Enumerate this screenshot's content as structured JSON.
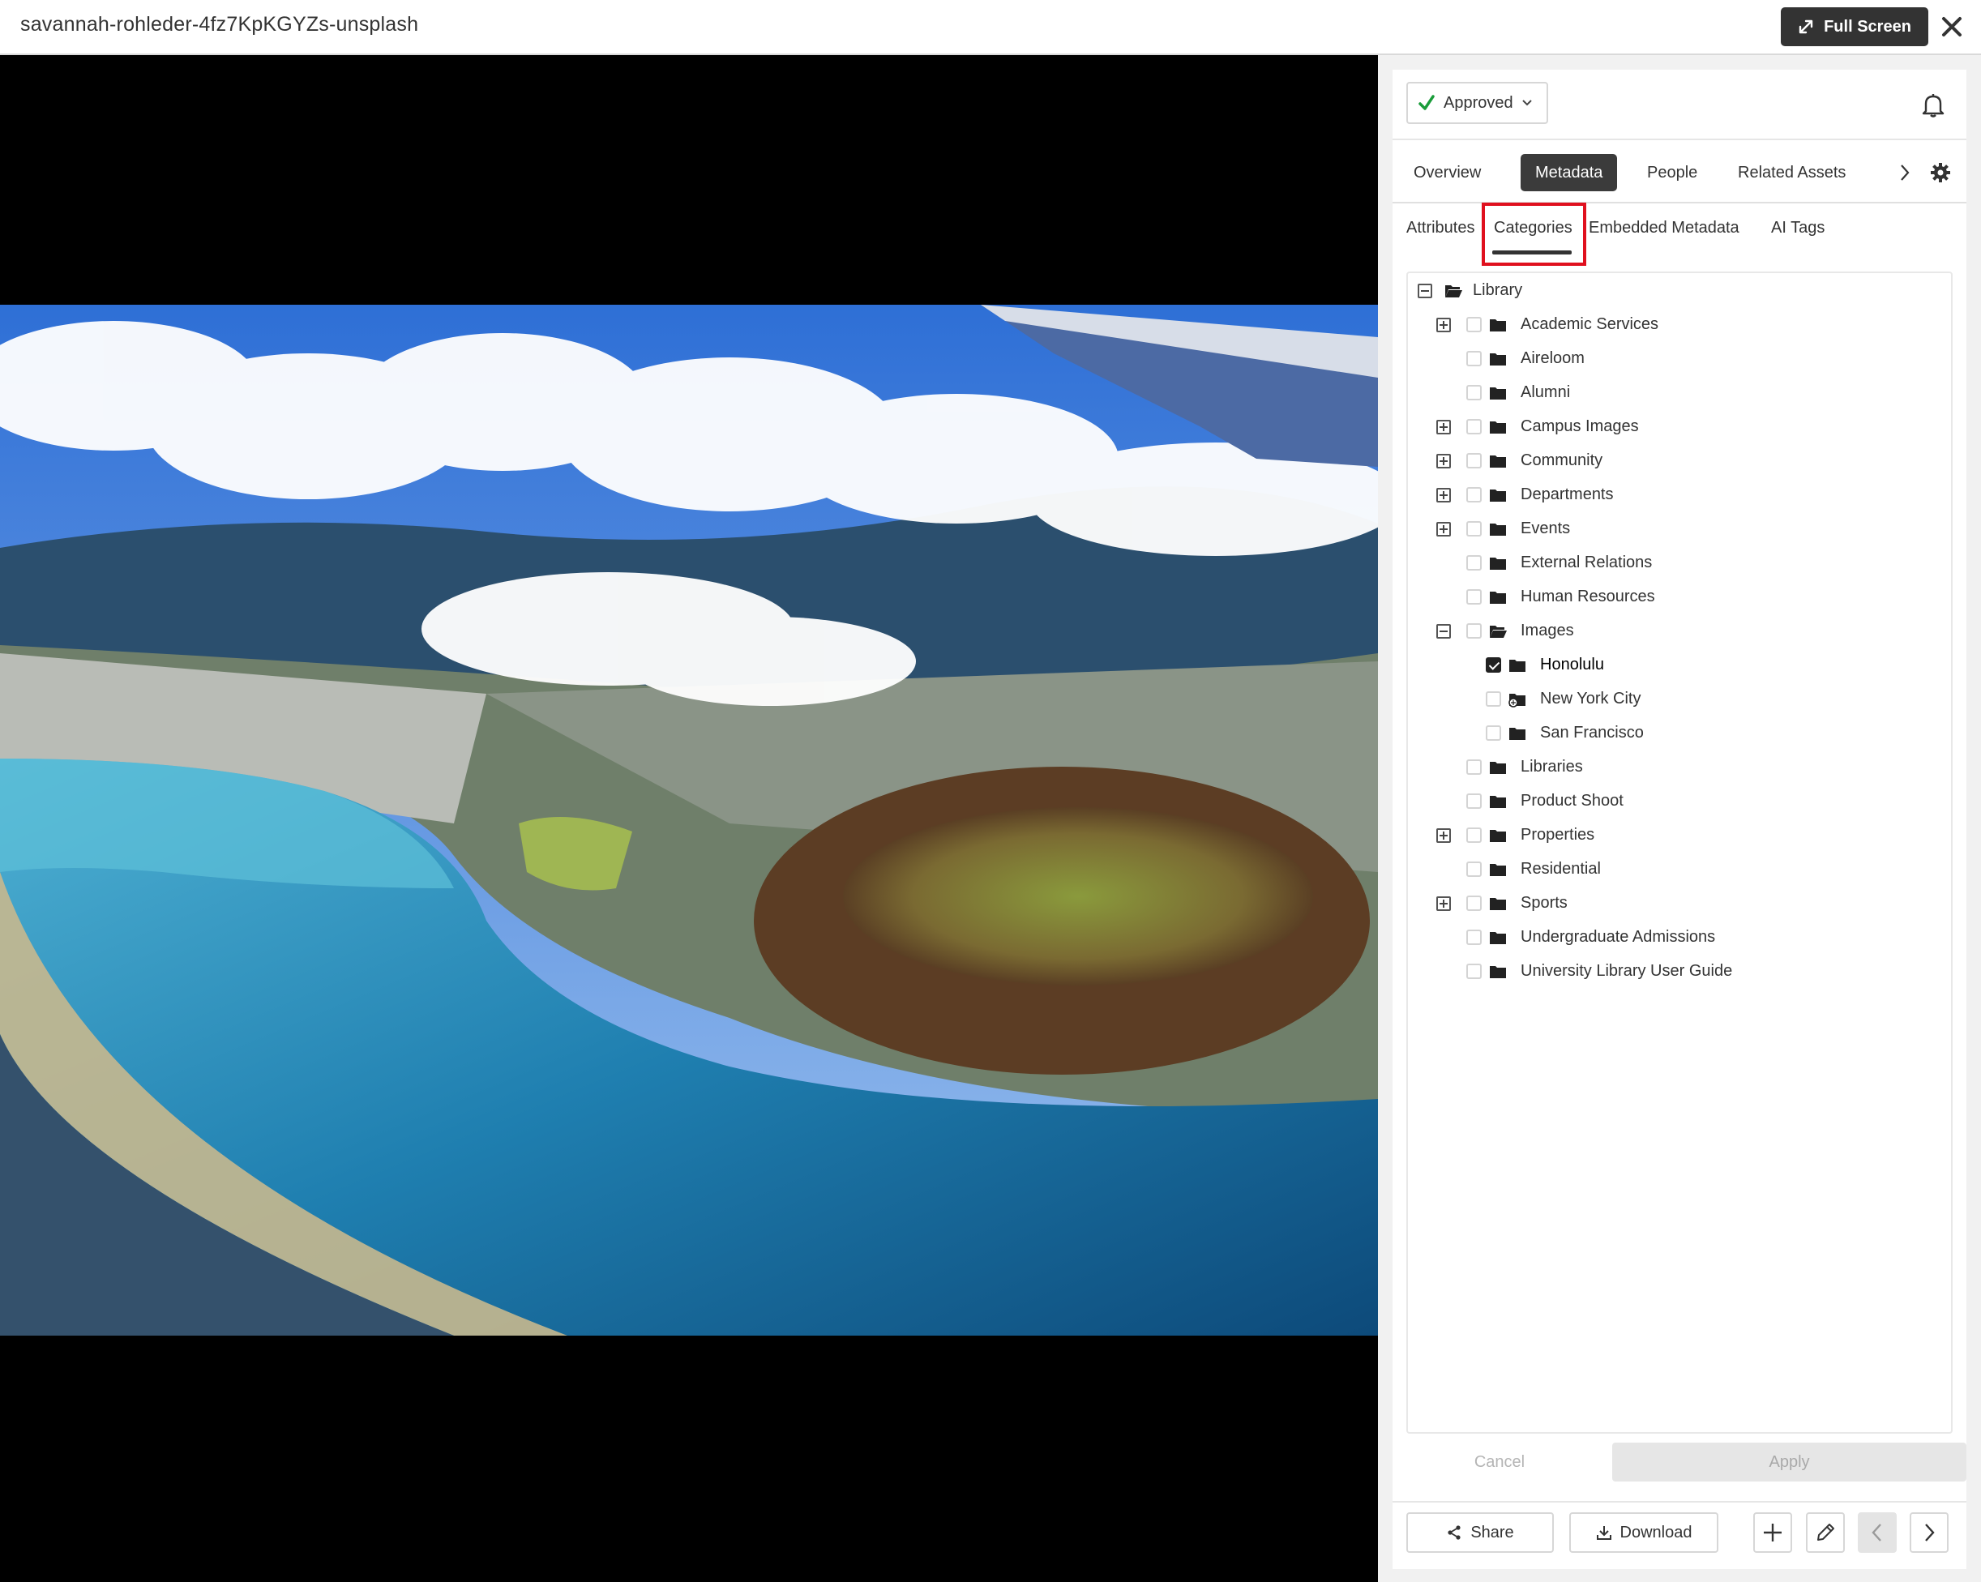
{
  "header": {
    "title": "savannah-rohleder-4fz7KpKGYZs-unsplash",
    "fullscreen_label": "Full Screen"
  },
  "panel": {
    "status": {
      "label": "Approved",
      "color": "#1a9c3a"
    },
    "tabs": [
      {
        "label": "Overview",
        "active": false
      },
      {
        "label": "Metadata",
        "active": true
      },
      {
        "label": "People",
        "active": false
      },
      {
        "label": "Related Assets",
        "active": false
      }
    ],
    "subtabs": [
      {
        "label": "Attributes",
        "active": false
      },
      {
        "label": "Categories",
        "active": true
      },
      {
        "label": "Embedded Metadata",
        "active": false
      },
      {
        "label": "AI Tags",
        "active": false
      }
    ],
    "highlight_color": "#e0101e",
    "tree": [
      {
        "label": "Library",
        "level": 0,
        "toggle": "minus",
        "checkbox": false,
        "checked": false,
        "folder": "open"
      },
      {
        "label": "Academic Services",
        "level": 1,
        "toggle": "plus",
        "checkbox": true,
        "checked": false,
        "folder": "closed"
      },
      {
        "label": "Aireloom",
        "level": 1,
        "toggle": "none",
        "checkbox": true,
        "checked": false,
        "folder": "closed"
      },
      {
        "label": "Alumni",
        "level": 1,
        "toggle": "none",
        "checkbox": true,
        "checked": false,
        "folder": "closed"
      },
      {
        "label": "Campus Images",
        "level": 1,
        "toggle": "plus",
        "checkbox": true,
        "checked": false,
        "folder": "closed"
      },
      {
        "label": "Community",
        "level": 1,
        "toggle": "plus",
        "checkbox": true,
        "checked": false,
        "folder": "closed"
      },
      {
        "label": "Departments",
        "level": 1,
        "toggle": "plus",
        "checkbox": true,
        "checked": false,
        "folder": "closed"
      },
      {
        "label": "Events",
        "level": 1,
        "toggle": "plus",
        "checkbox": true,
        "checked": false,
        "folder": "closed"
      },
      {
        "label": "External Relations",
        "level": 1,
        "toggle": "none",
        "checkbox": true,
        "checked": false,
        "folder": "closed"
      },
      {
        "label": "Human Resources",
        "level": 1,
        "toggle": "none",
        "checkbox": true,
        "checked": false,
        "folder": "closed"
      },
      {
        "label": "Images",
        "level": 1,
        "toggle": "minus",
        "checkbox": true,
        "checked": false,
        "folder": "open"
      },
      {
        "label": "Honolulu",
        "level": 2,
        "toggle": "none",
        "checkbox": true,
        "checked": true,
        "folder": "closed"
      },
      {
        "label": "New York City",
        "level": 2,
        "toggle": "none",
        "checkbox": true,
        "checked": false,
        "folder": "shared"
      },
      {
        "label": "San Francisco",
        "level": 2,
        "toggle": "none",
        "checkbox": true,
        "checked": false,
        "folder": "closed"
      },
      {
        "label": "Libraries",
        "level": 1,
        "toggle": "none",
        "checkbox": true,
        "checked": false,
        "folder": "closed"
      },
      {
        "label": "Product Shoot",
        "level": 1,
        "toggle": "none",
        "checkbox": true,
        "checked": false,
        "folder": "closed"
      },
      {
        "label": "Properties",
        "level": 1,
        "toggle": "plus",
        "checkbox": true,
        "checked": false,
        "folder": "closed"
      },
      {
        "label": "Residential",
        "level": 1,
        "toggle": "none",
        "checkbox": true,
        "checked": false,
        "folder": "closed"
      },
      {
        "label": "Sports",
        "level": 1,
        "toggle": "plus",
        "checkbox": true,
        "checked": false,
        "folder": "closed"
      },
      {
        "label": "Undergraduate Admissions",
        "level": 1,
        "toggle": "none",
        "checkbox": true,
        "checked": false,
        "folder": "closed"
      },
      {
        "label": "University Library User Guide",
        "level": 1,
        "toggle": "none",
        "checkbox": true,
        "checked": false,
        "folder": "closed"
      }
    ],
    "actions": {
      "cancel_label": "Cancel",
      "apply_label": "Apply"
    },
    "footer": {
      "share_label": "Share",
      "download_label": "Download",
      "icons": [
        "add-icon",
        "edit-icon",
        "previous-icon",
        "next-icon"
      ]
    }
  }
}
